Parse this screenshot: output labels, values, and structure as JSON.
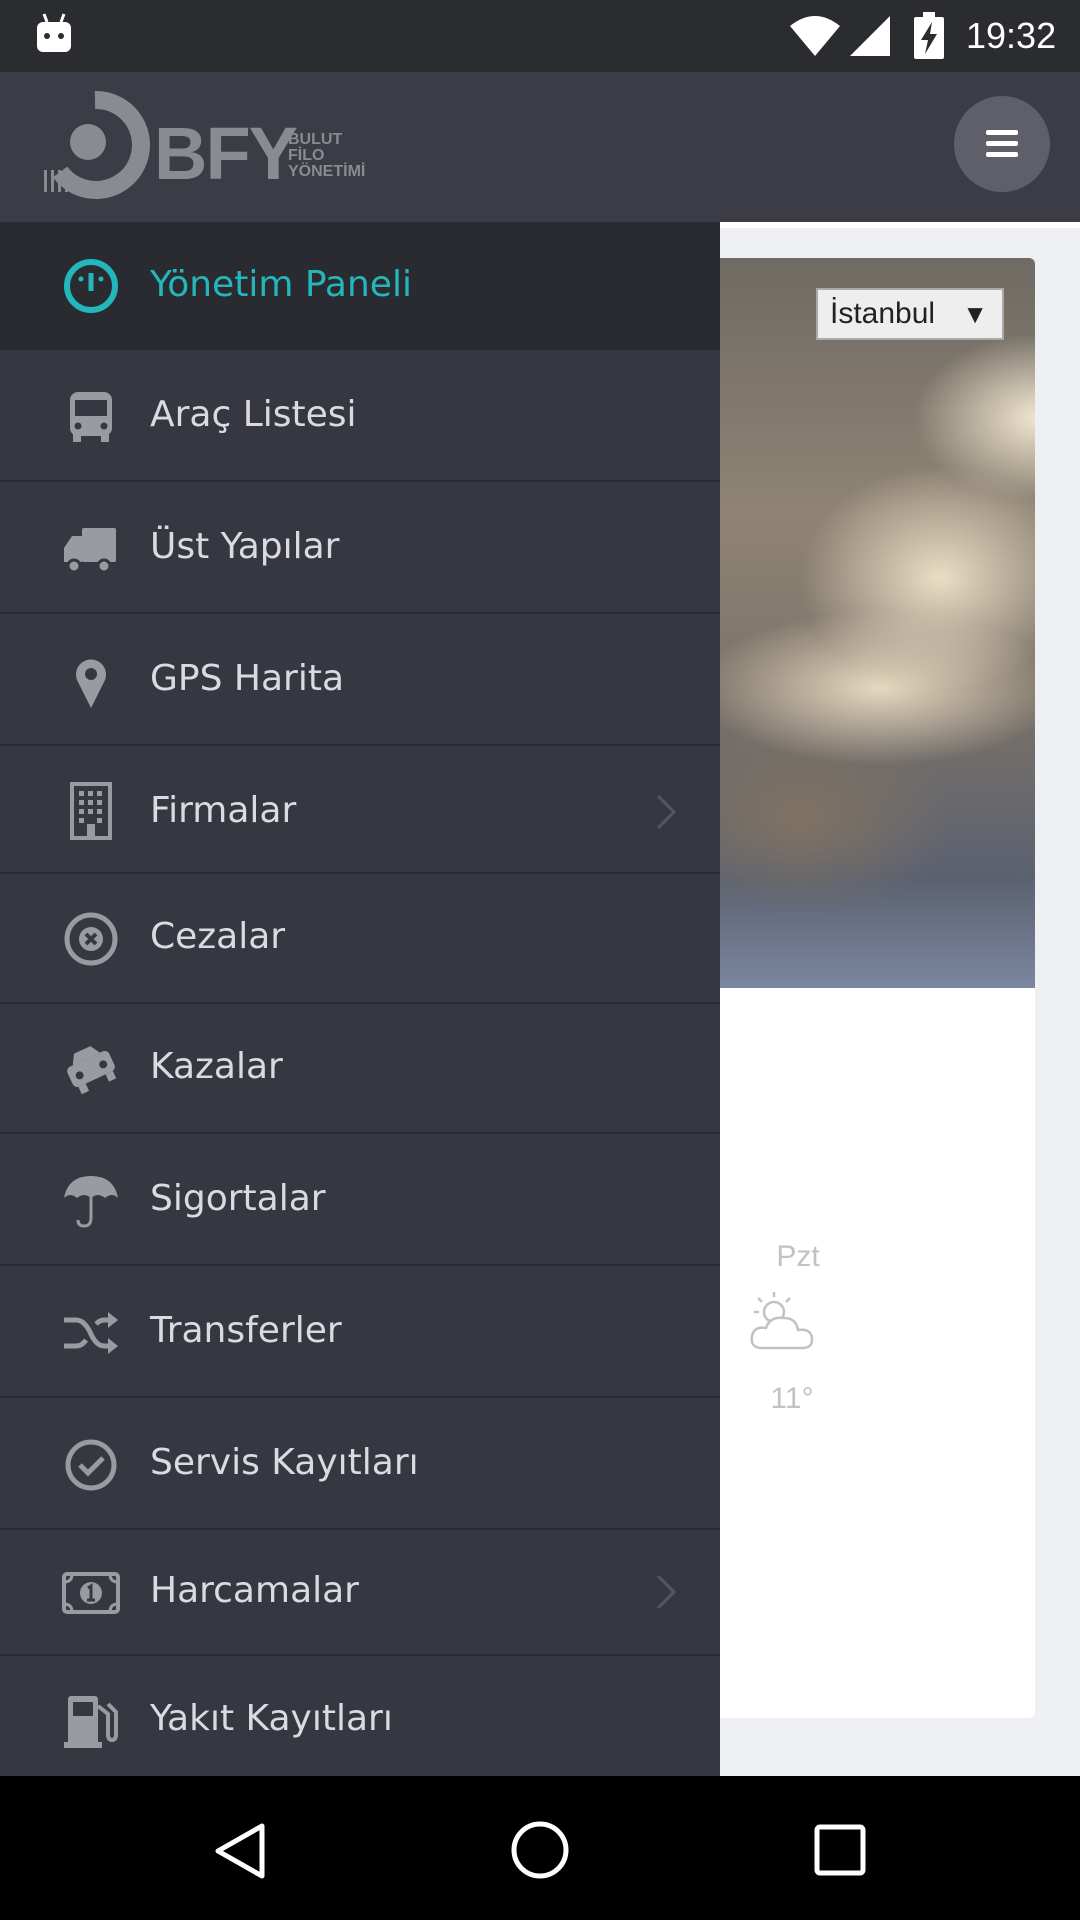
{
  "status_bar": {
    "time": "19:32"
  },
  "header": {
    "logo_text": "BFY",
    "logo_subtitle": [
      "BULUT",
      "FİLO",
      "YÖNETİMİ"
    ]
  },
  "weather": {
    "city_selected": "İstanbul",
    "forecast": [
      {
        "day": "Pzt",
        "temp": "11°",
        "icon": "partly-cloudy-icon"
      }
    ]
  },
  "drawer": {
    "items": [
      {
        "label": "Yönetim Paneli",
        "icon": "dashboard-icon",
        "active": true
      },
      {
        "label": "Araç Listesi",
        "icon": "bus-icon"
      },
      {
        "label": "Üst Yapılar",
        "icon": "truck-icon"
      },
      {
        "label": "GPS Harita",
        "icon": "map-marker-icon"
      },
      {
        "label": "Firmalar",
        "icon": "building-icon",
        "has_submenu": true
      },
      {
        "label": "Cezalar",
        "icon": "circle-x-icon"
      },
      {
        "label": "Kazalar",
        "icon": "car-crash-icon"
      },
      {
        "label": "Sigortalar",
        "icon": "umbrella-icon"
      },
      {
        "label": "Transferler",
        "icon": "shuffle-icon"
      },
      {
        "label": "Servis Kayıtları",
        "icon": "check-circle-icon"
      },
      {
        "label": "Harcamalar",
        "icon": "money-icon",
        "has_submenu": true
      },
      {
        "label": "Yakıt Kayıtları",
        "icon": "fuel-pump-icon"
      }
    ]
  },
  "colors": {
    "accent": "#23b7bb",
    "drawer_bg": "#363740",
    "header_bg": "#3b3c45",
    "status_bg": "#2b2c30"
  }
}
